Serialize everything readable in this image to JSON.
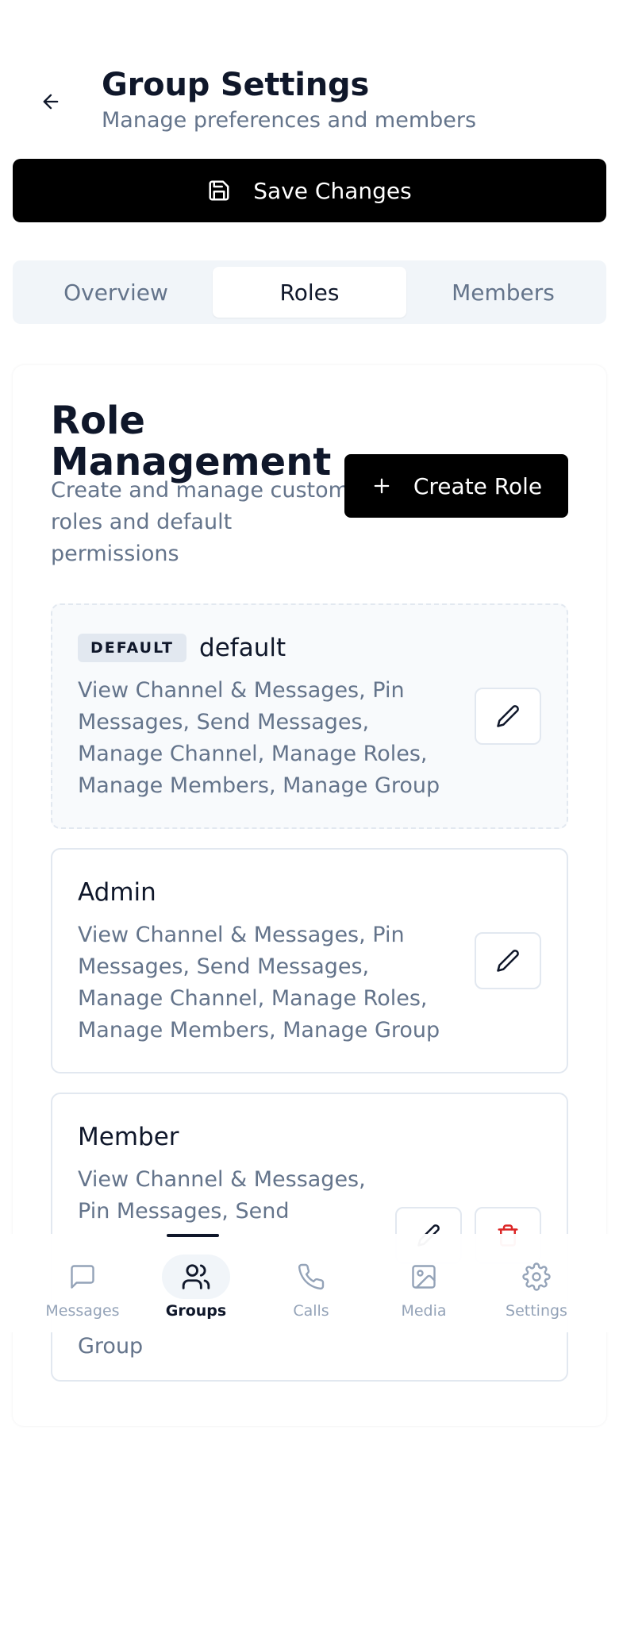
{
  "header": {
    "title": "Group Settings",
    "subtitle": "Manage preferences and members"
  },
  "actions": {
    "save_label": "Save Changes"
  },
  "tabs": [
    {
      "label": "Overview",
      "active": false
    },
    {
      "label": "Roles",
      "active": true
    },
    {
      "label": "Members",
      "active": false
    }
  ],
  "role_management": {
    "title": "Role Management",
    "description": "Create and manage custom roles and default permissions",
    "create_label": "Create Role"
  },
  "roles": [
    {
      "badge": "DEFAULT",
      "name": "default",
      "permissions": "View Channel & Messages, Pin Messages, Send Messages, Manage Channel, Manage Roles, Manage Members, Manage Group"
    },
    {
      "name": "Admin",
      "permissions": "View Channel & Messages, Pin Messages, Send Messages, Manage Channel, Manage Roles, Manage Members, Manage Group"
    },
    {
      "name": "Member",
      "permissions_visible_top": "View Channel & Messages, Pin Messages, Send",
      "permissions_visible_bottom": "Group"
    }
  ],
  "bottom_nav": [
    {
      "label": "Messages",
      "icon": "message-icon",
      "active": false
    },
    {
      "label": "Groups",
      "icon": "users-icon",
      "active": true
    },
    {
      "label": "Calls",
      "icon": "phone-icon",
      "active": false
    },
    {
      "label": "Media",
      "icon": "image-icon",
      "active": false
    },
    {
      "label": "Settings",
      "icon": "gear-icon",
      "active": false
    }
  ],
  "colors": {
    "primary": "#000000",
    "heading": "#0f172a",
    "muted": "#64748b",
    "border": "#e2e8f0",
    "danger": "#dc2626"
  }
}
